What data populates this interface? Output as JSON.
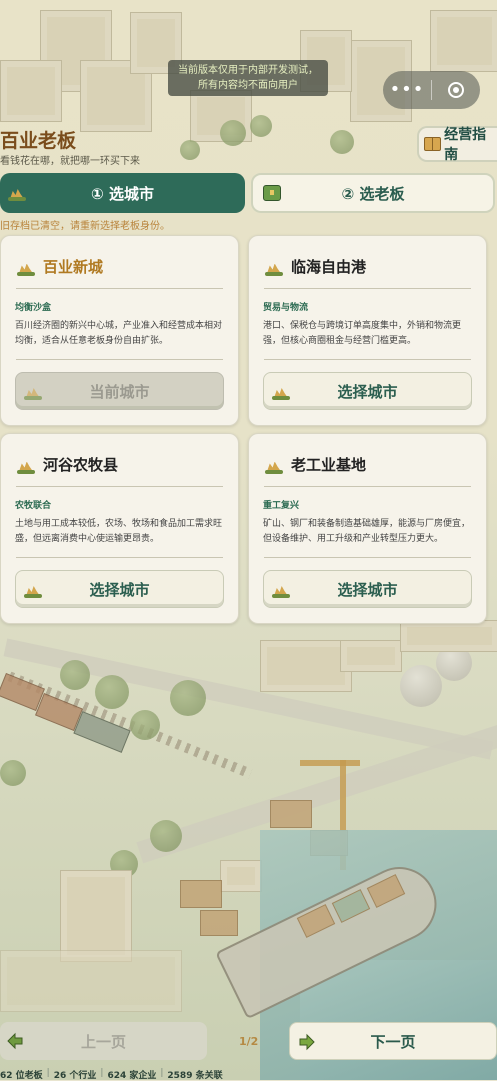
{
  "notice": {
    "line1": "当前版本仅用于内部开发测试，",
    "line2": "所有内容均不面向用户"
  },
  "capsule": {
    "more_icon": "more-dots-icon",
    "close_icon": "target-close-icon"
  },
  "header": {
    "title": "百业老板",
    "subtitle": "看钱花在哪，就把哪一环买下来",
    "guide_button": "经营指南"
  },
  "tabs": [
    {
      "label": "① 选城市",
      "active": true
    },
    {
      "label": "② 选老板",
      "active": false
    }
  ],
  "hint": "旧存档已清空，请重新选择老板身份。",
  "cities": [
    {
      "name": "百业新城",
      "tag": "均衡沙盒",
      "desc": "百川经济圈的新兴中心城，产业准入和经营成本相对均衡，适合从任意老板身份自由扩张。",
      "button": "当前城市",
      "current": true
    },
    {
      "name": "临海自由港",
      "tag": "贸易与物流",
      "desc": "港口、保税仓与跨境订单高度集中，外销和物流更强，但核心商圈租金与经营门槛更高。",
      "button": "选择城市",
      "current": false
    },
    {
      "name": "河谷农牧县",
      "tag": "农牧联合",
      "desc": "土地与用工成本较低，农场、牧场和食品加工需求旺盛，但远离消费中心使运输更昂贵。",
      "button": "选择城市",
      "current": false
    },
    {
      "name": "老工业基地",
      "tag": "重工复兴",
      "desc": "矿山、钢厂和装备制造基础雄厚，能源与厂房便宜，但设备维护、用工升级和产业转型压力更大。",
      "button": "选择城市",
      "current": false
    }
  ],
  "footer": {
    "prev": "上一页",
    "next": "下一页",
    "page": "1/2",
    "stats": [
      "62 位老板",
      "26 个行业",
      "624 家企业",
      "2589 条关联"
    ]
  },
  "colors": {
    "primary": "#2e6b59",
    "title_brown": "#7a4d1c",
    "accent_gold": "#b07a22",
    "tag_green": "#2c6b52",
    "hint_orange": "#b9843c"
  }
}
